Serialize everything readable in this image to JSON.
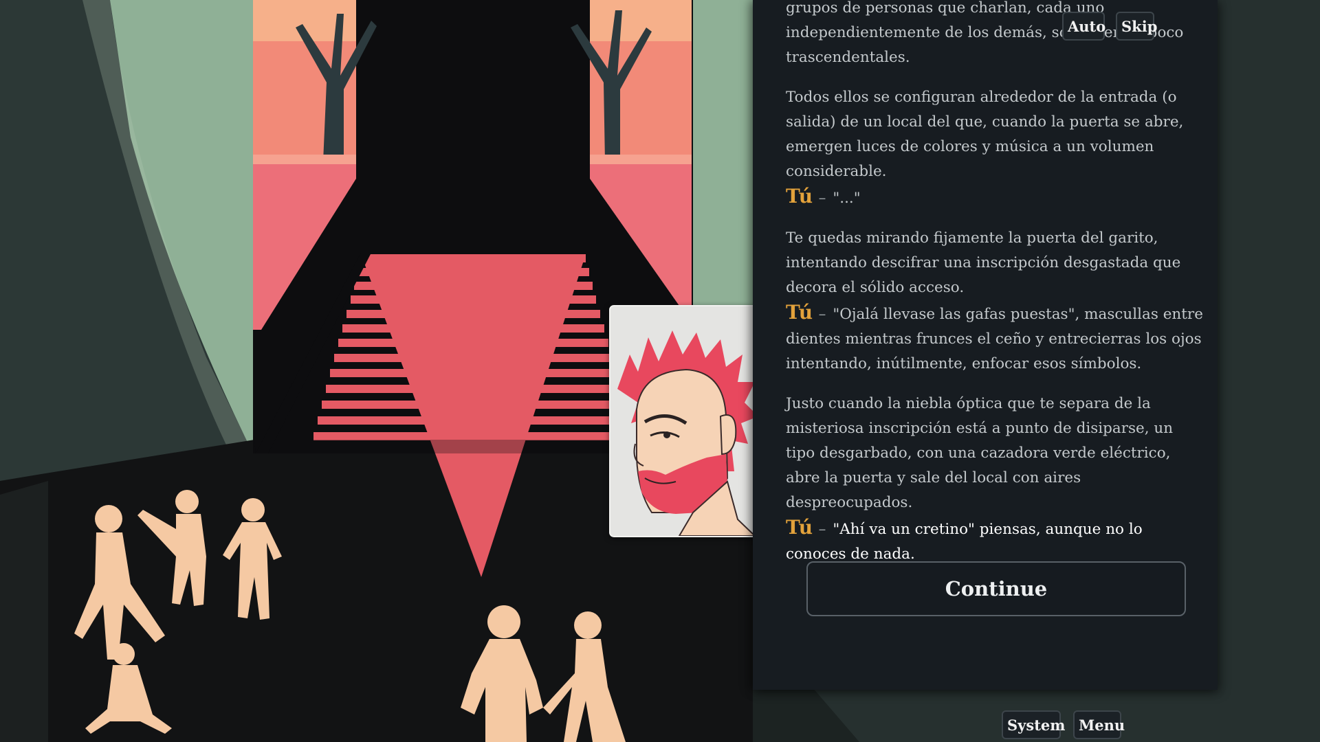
{
  "top_buttons": {
    "auto": "Auto",
    "skip": "Skip"
  },
  "bottom_buttons": {
    "system": "System",
    "menu": "Menu"
  },
  "dialog": {
    "p1": "grupos de personas que charlan, cada uno independientemente de los demás, sobre temas poco trascendentales.",
    "p2": "Todos ellos se configuran alrededor de la entrada (o salida) de un local del que, cuando la puerta se abre, emergen luces de colores y música a un volumen considerable.",
    "line1": {
      "speaker": "Tú",
      "dash": "–",
      "text": "\"...\""
    },
    "p3": "Te quedas mirando fijamente la puerta del garito, intentando descifrar una inscripción desgastada que decora el sólido acceso.",
    "line2": {
      "speaker": "Tú",
      "dash": "–",
      "text": "\"Ojalá llevase las gafas puestas\", mascullas entre dientes mientras frunces el ceño y entrecierras los ojos intentando, inútilmente, enfocar esos símbolos."
    },
    "p4": "Justo cuando la niebla óptica que te separa de la misteriosa inscripción está a punto de disiparse, un tipo desgarbado, con una cazadora verde eléctrico, abre la puerta y sale del local con aires despreocupados.",
    "line3": {
      "speaker": "Tú",
      "dash": "–",
      "text": "\"Ahí va un cretino\" piensas, aunque no lo conoces de nada."
    }
  },
  "continue_label": "Continue",
  "colors": {
    "speaker": "#e3a23b",
    "panel_bg": "#171c21",
    "stairs": "#e45a64",
    "figures": "#f5c9a3",
    "wall_green": "#8fb096"
  },
  "icons": {
    "portrait": "character-portrait-red-haired-bearded-man"
  }
}
